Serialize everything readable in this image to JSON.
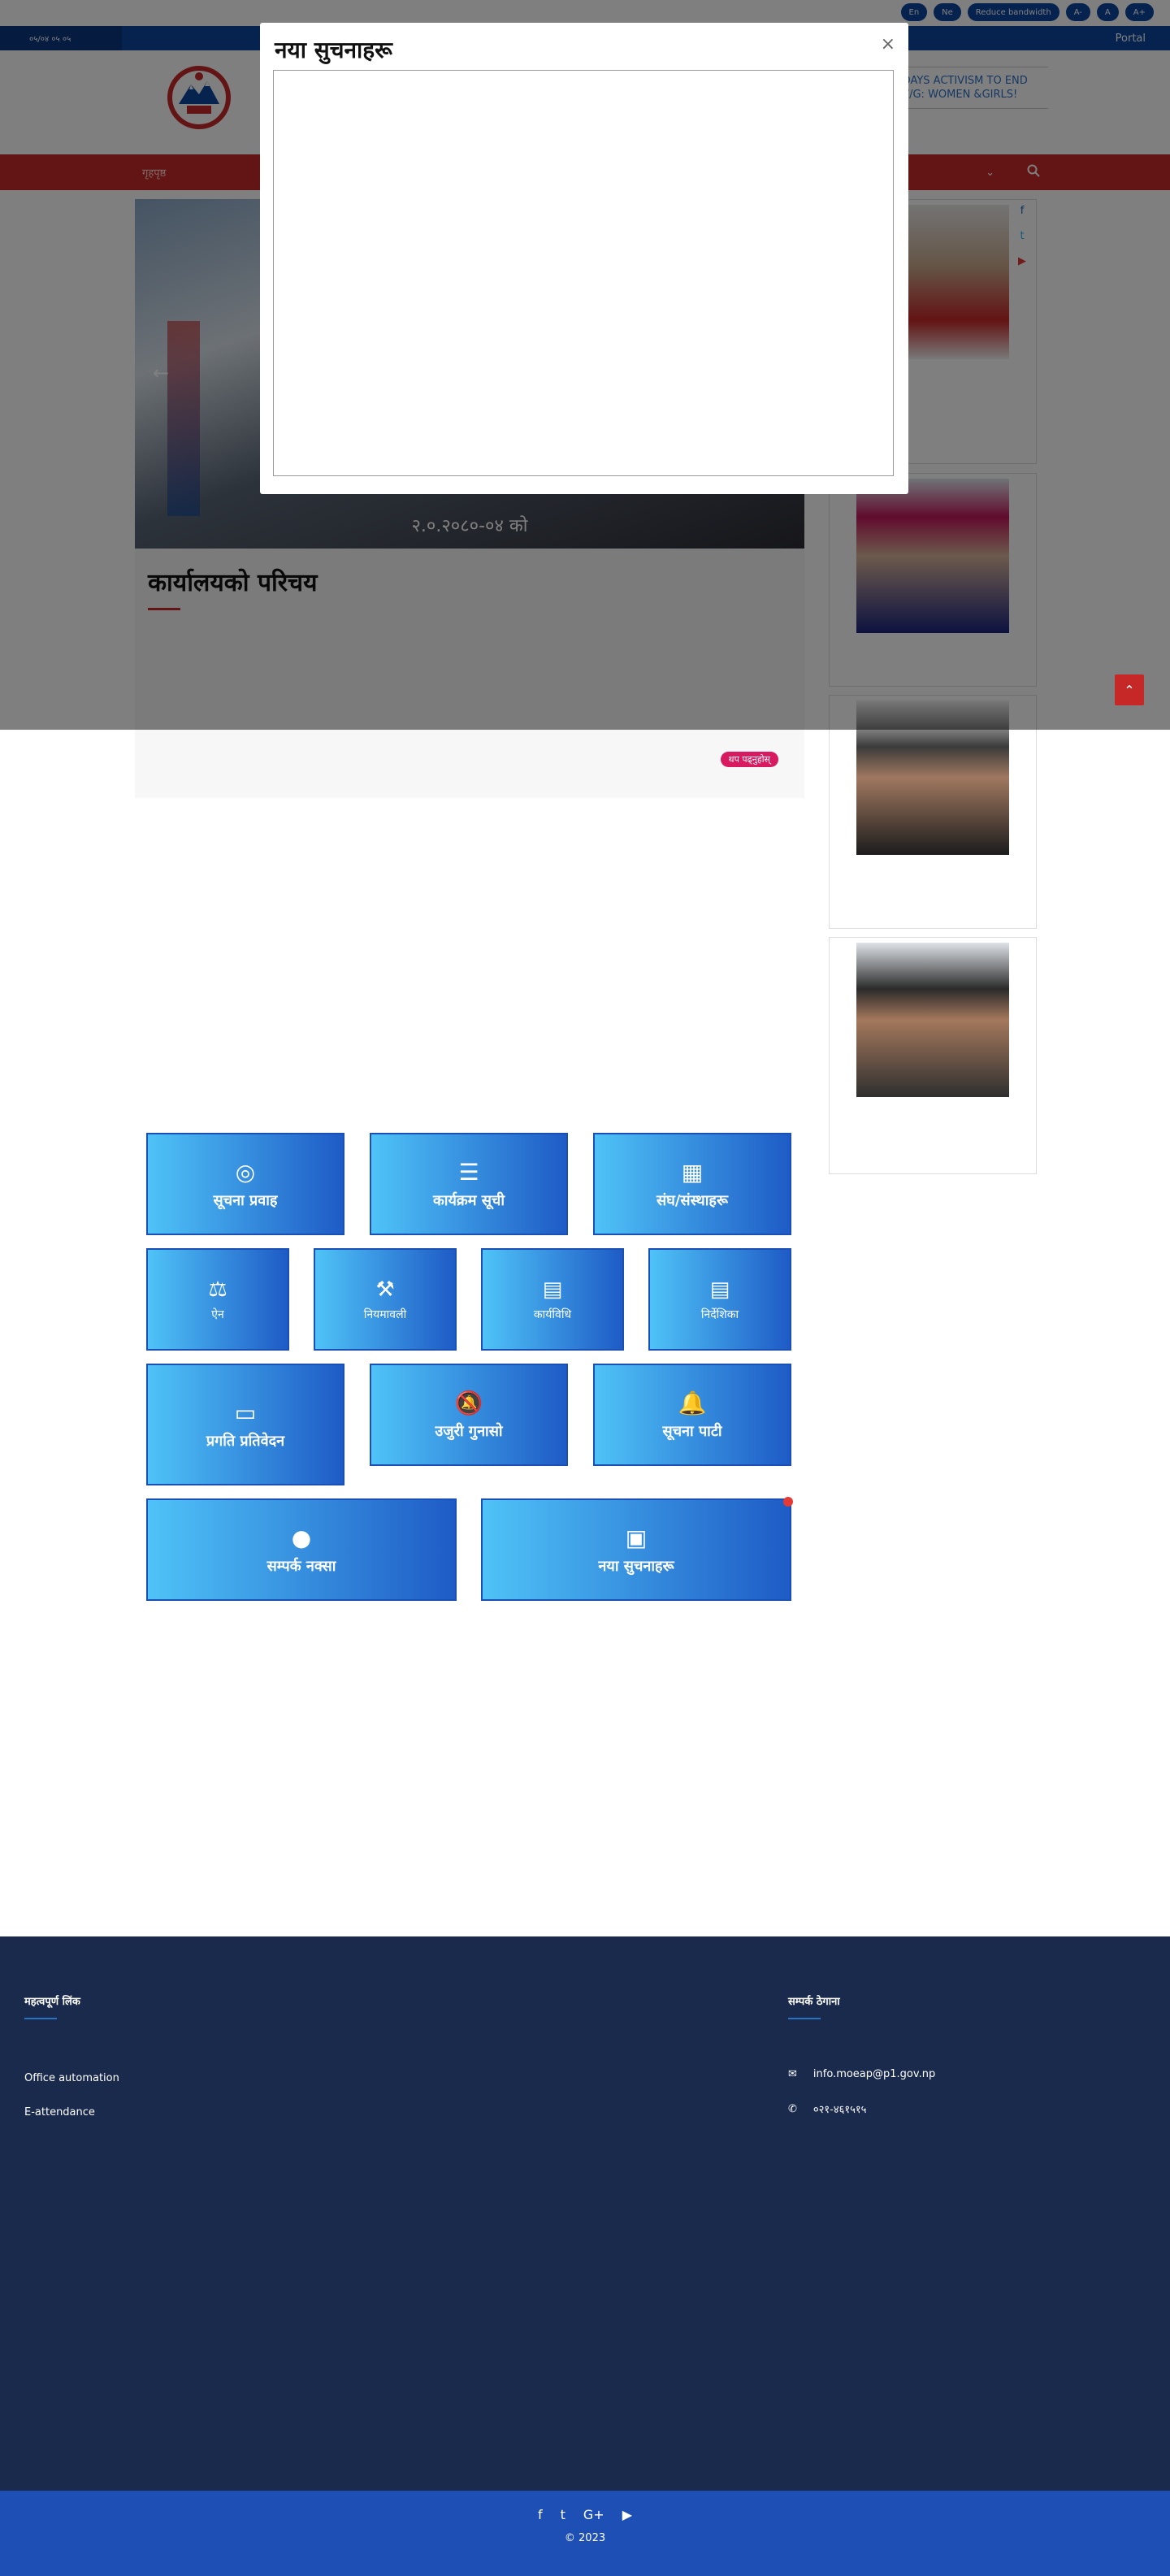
{
  "top": {
    "date": "०५/०४  ०५ ०५",
    "lang_en": "En",
    "lang_ne": "Ne",
    "reduce_bandwidth": "Reduce bandwidth",
    "font_minus": "A-",
    "font_normal": "A",
    "font_plus": "A+",
    "portal": "Portal"
  },
  "header": {
    "ticker": "16 DAYS ACTIVISM TO END VAW/G: WOMEN &GIRLS!"
  },
  "nav": {
    "home": "गृहपृष्ठ"
  },
  "slider": {
    "caption": "२.०.२०८०-०४ को"
  },
  "about": {
    "heading": "कार्यालयको परिचय",
    "more": "थप पढ्नुहोस्"
  },
  "modal": {
    "title": "नया सुचनाहरू",
    "close": "×"
  },
  "tiles": {
    "t1": "सूचना प्रवाह",
    "t2": "कार्यक्रम सूची",
    "t3": "संघ/संस्थाहरू",
    "t4": "ऐन",
    "t5": "नियमावली",
    "t6": "कार्यविधि",
    "t7": "निर्देशिका",
    "t8": "प्रगति प्रतिवेदन",
    "t9": "उजुरी गुनासो",
    "t10": "सूचना पाटी",
    "t11": "सम्पर्क नक्सा",
    "t12": "नया सुचनाहरू"
  },
  "footer": {
    "col1_title": "महत्वपूर्ण लिंक",
    "office_automation": "Office automation",
    "e_attendance": "E-attendance",
    "col3_title": "सम्पर्क ठेगाना",
    "email": "info.moeap@p1.gov.np",
    "phone": "०२१-४६१५१५"
  },
  "bottom": {
    "copyright": "© 2023"
  },
  "colors": {
    "nav": "#c62828",
    "brand_blue": "#0d47a1",
    "footer": "#1a2a4d",
    "bottom": "#1e4fb4"
  }
}
